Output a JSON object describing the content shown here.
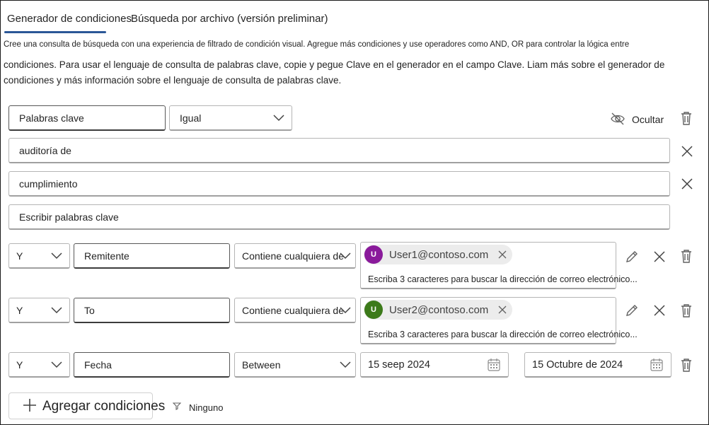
{
  "tabs": [
    {
      "label": "Generador de condiciones",
      "active": true
    },
    {
      "label": "Búsqueda por archivo (versión preliminar)",
      "active": false
    }
  ],
  "description": {
    "line1": "Cree una consulta de búsqueda con una experiencia de filtrado de condición visual. Agregue más condiciones y use operadores como AND, OR para controlar la lógica entre",
    "line2": "condiciones. Para usar el lenguaje de consulta de palabras clave, copie y pegue Clave en el generador en el campo Clave. Liam más sobre el generador de condiciones y más información sobre el lenguaje de consulta de palabras clave."
  },
  "keyword_condition": {
    "field": "Palabras clave",
    "operator": "Igual",
    "hide_label": "Ocultar",
    "values": [
      "auditoría de",
      "cumplimiento"
    ],
    "placeholder": "Escribir palabras clave"
  },
  "conditions": [
    {
      "connector": "Y",
      "field": "Remitente",
      "operator": "Contiene cualquiera de",
      "chip": {
        "initial": "U",
        "text": "User1@contoso.com",
        "color": "#8a1a9b"
      },
      "hint": "Escriba 3 caracteres para buscar la dirección de correo electrónico..."
    },
    {
      "connector": "Y",
      "field": "To",
      "operator": "Contiene cualquiera de",
      "chip": {
        "initial": "U",
        "text": "User2@contoso.com",
        "color": "#3c7a1a"
      },
      "hint": "Escriba 3 caracteres para buscar la dirección de correo electrónico..."
    },
    {
      "connector": "Y",
      "field": "Fecha",
      "operator": "Between",
      "date_from": "15 seep 2024",
      "date_to": "15 Octubre de 2024"
    }
  ],
  "add_button_label": "Agregar condiciones",
  "none_label": "Ninguno",
  "colors": {
    "accent": "#2b5797"
  }
}
